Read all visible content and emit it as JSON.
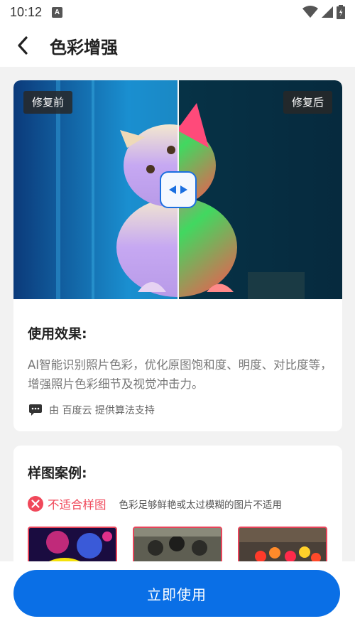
{
  "status_bar": {
    "time": "10:12",
    "notification_icon": "A"
  },
  "header": {
    "title": "色彩增强"
  },
  "compare": {
    "before_label": "修复前",
    "after_label": "修复后"
  },
  "effect": {
    "title": "使用效果:",
    "description": "AI智能识别照片色彩，优化原图饱和度、明度、对比度等，增强照片色彩细节及视觉冲击力。",
    "provider": "由 百度云 提供算法支持"
  },
  "samples": {
    "title": "样图案例:",
    "unsuitable_label": "不适合样图",
    "unsuitable_hint": "色彩足够鲜艳或太过模糊的图片不适用"
  },
  "cta": {
    "label": "立即使用"
  },
  "colors": {
    "primary": "#0a6fe6",
    "danger": "#f0485a"
  }
}
